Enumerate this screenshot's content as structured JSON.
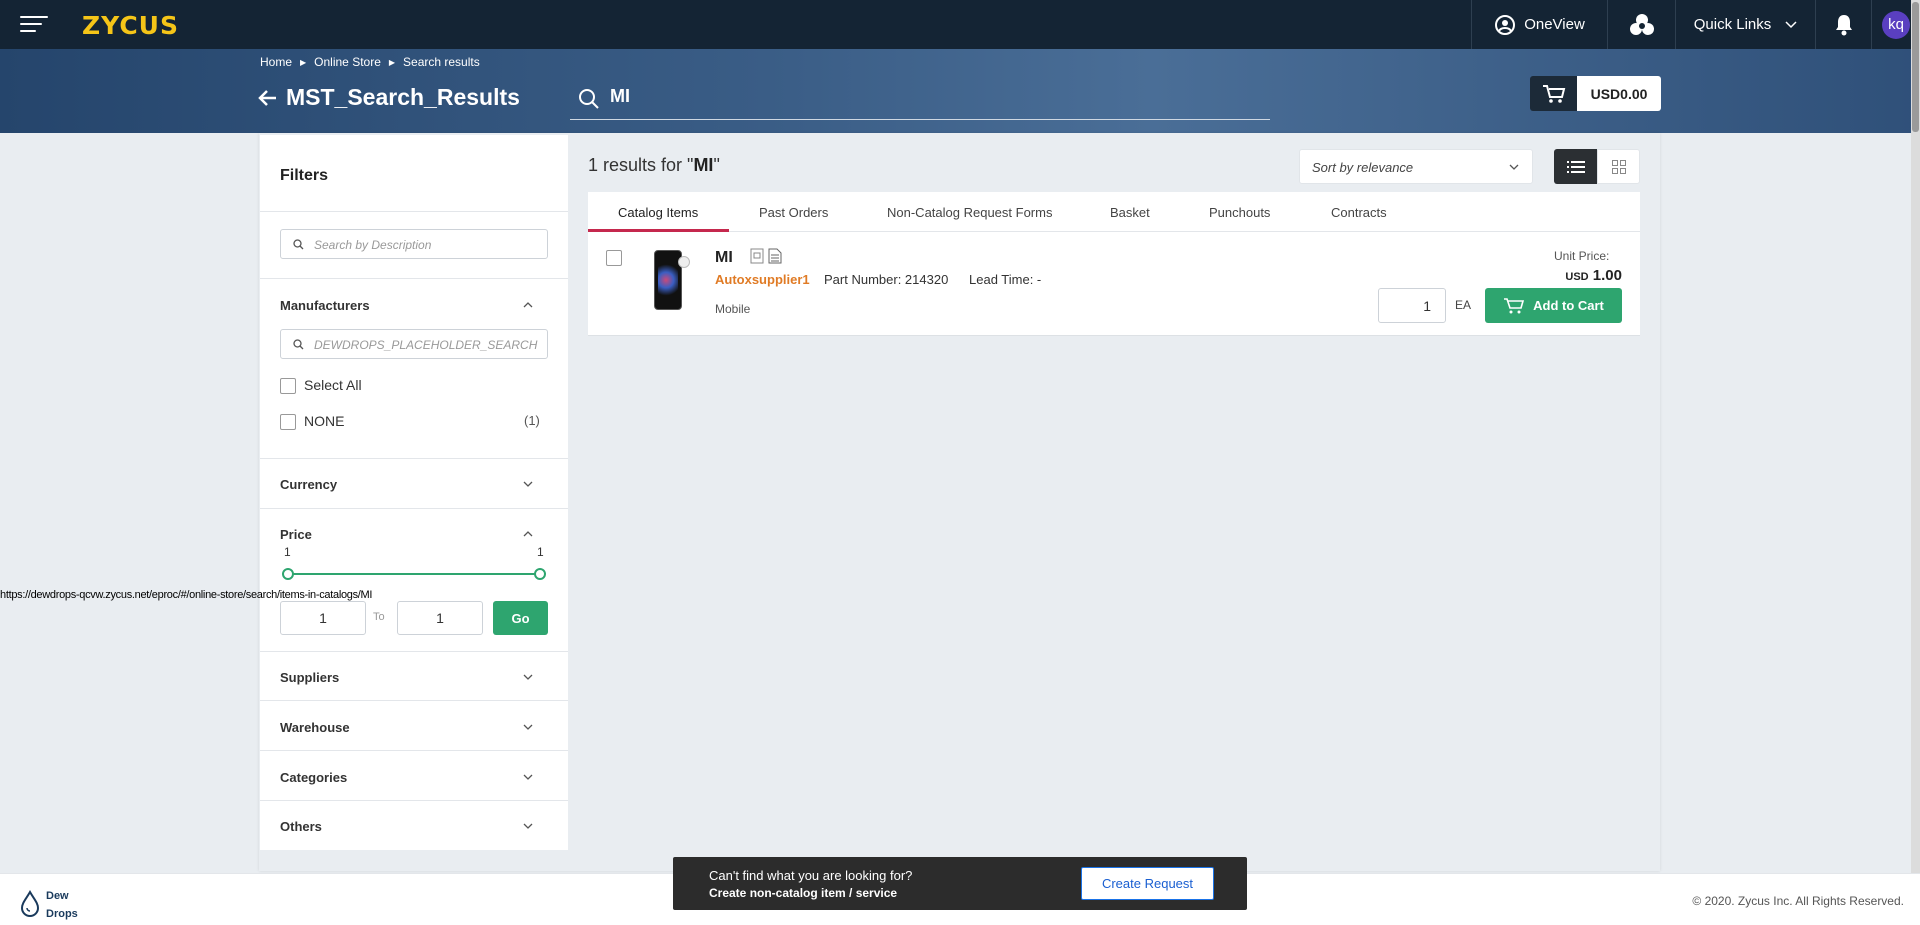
{
  "app": {
    "logo": "ZYCUS"
  },
  "topbar": {
    "oneview_label": "OneView",
    "quick_links_label": "Quick Links",
    "avatar_initials": "kq"
  },
  "breadcrumb": {
    "items": [
      "Home",
      "Online Store",
      "Search results"
    ]
  },
  "page": {
    "title": "MST_Search_Results"
  },
  "search": {
    "query": "MI"
  },
  "cart": {
    "amount": "USD0.00"
  },
  "filters": {
    "title": "Filters",
    "description_search_placeholder": "Search by Description",
    "manufacturers": {
      "heading": "Manufacturers",
      "search_placeholder": "DEWDROPS_PLACEHOLDER_SEARCH",
      "select_all_label": "Select All",
      "options": [
        {
          "label": "NONE",
          "count": "(1)"
        }
      ]
    },
    "currency_heading": "Currency",
    "price": {
      "heading": "Price",
      "min_label": "1",
      "max_label": "1",
      "from_value": "1",
      "to_label": "To",
      "to_value": "1",
      "go_label": "Go"
    },
    "suppliers_heading": "Suppliers",
    "warehouse_heading": "Warehouse",
    "categories_heading": "Categories",
    "others_heading": "Others"
  },
  "status_url": "https://dewdrops-qcvw.zycus.net/eproc/#/online-store/search/items-in-catalogs/MI",
  "results": {
    "count_prefix": "1 results for \"",
    "query": "MI",
    "count_suffix": "\"",
    "sort_label": "Sort by relevance",
    "tabs": [
      "Catalog Items",
      "Past Orders",
      "Non-Catalog Request Forms",
      "Basket",
      "Punchouts",
      "Contracts"
    ],
    "items": [
      {
        "name": "MI",
        "supplier": "Autoxsupplier1",
        "part_number": "Part Number: 214320",
        "lead_time": "Lead Time: -",
        "category": "Mobile",
        "unit_price_label": "Unit Price:",
        "currency": "USD",
        "price": "1.00",
        "quantity": "1",
        "uom": "EA",
        "add_to_cart_label": "Add to Cart"
      }
    ]
  },
  "toast": {
    "line1": "Can't find what you are looking for?",
    "line2": "Create non-catalog item / service",
    "button_label": "Create Request"
  },
  "footer": {
    "brand_line1": "Dew",
    "brand_line2": "Drops",
    "copyright": "© 2020. Zycus Inc. All Rights Reserved."
  },
  "colors": {
    "topbar": "#142434",
    "accent_green": "#2ea56f",
    "supplier_orange": "#e07b25",
    "tab_underline": "#c5284d"
  }
}
